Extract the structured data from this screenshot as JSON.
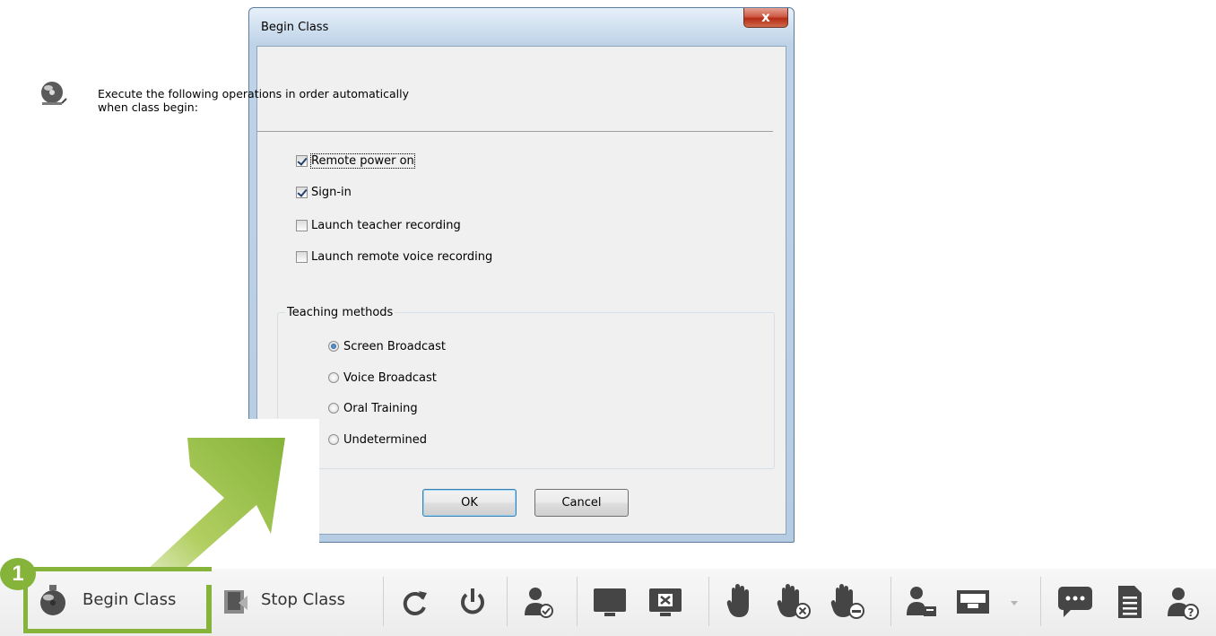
{
  "dialog": {
    "title": "Begin Class",
    "close_label": "x",
    "header_line1": "Execute the following operations in order automatically",
    "header_line2": "when class begin:",
    "options": [
      {
        "label": "Remote power on",
        "checked": true
      },
      {
        "label": "Sign-in",
        "checked": true
      },
      {
        "label": "Launch teacher recording",
        "checked": false
      },
      {
        "label": "Launch remote voice recording",
        "checked": false
      }
    ],
    "group_title": "Teaching methods",
    "methods": [
      {
        "label": "Screen Broadcast",
        "selected": true
      },
      {
        "label": "Voice Broadcast",
        "selected": false
      },
      {
        "label": "Oral Training",
        "selected": false
      },
      {
        "label": "Undetermined",
        "selected": false
      }
    ],
    "ok_label": "OK",
    "cancel_label": "Cancel"
  },
  "toolbar": {
    "begin_class": "Begin Class",
    "stop_class": "Stop Class",
    "step_number": "1",
    "icons": [
      "bell-icon",
      "stop-class-icon",
      "refresh-icon",
      "power-icon",
      "user-check-icon",
      "monitor-icon",
      "screen-close-icon",
      "hand-icon",
      "hand-cancel-icon",
      "hand-remove-icon",
      "user-desk-icon",
      "inbox-icon",
      "dropdown-arrow-icon",
      "chat-icon",
      "document-icon",
      "user-help-icon"
    ]
  },
  "colors": {
    "accent_green": "#86b33a"
  }
}
